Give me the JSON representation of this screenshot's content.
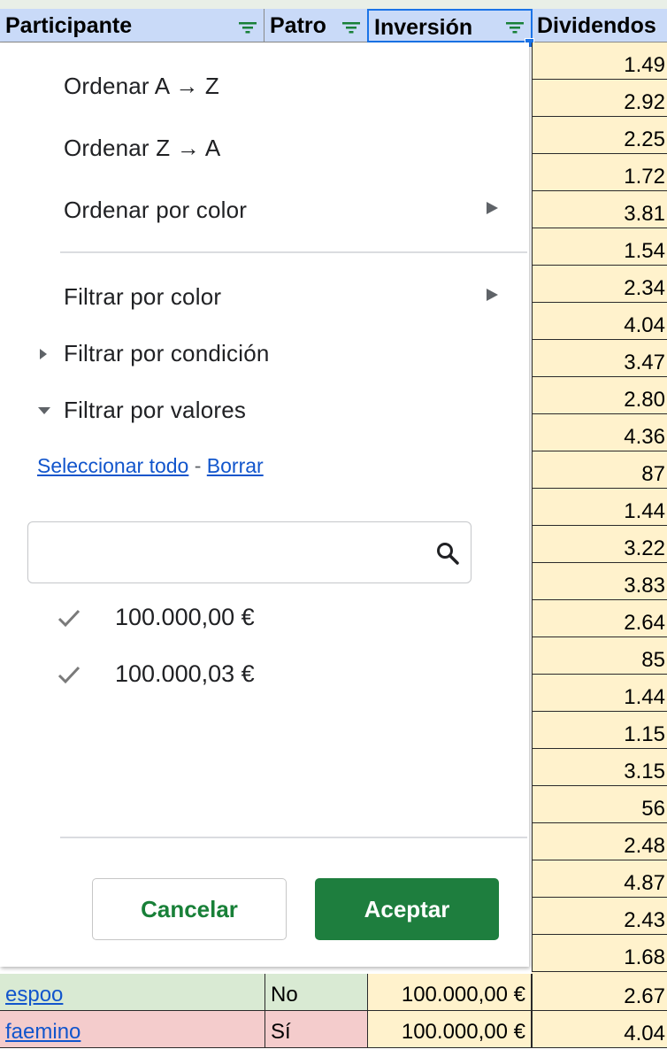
{
  "header": {
    "participante": "Participante",
    "patro": "Patro",
    "inversion": "Inversión",
    "dividendos": "Dividendos"
  },
  "dividendos_values": [
    "1.49",
    "2.92",
    "2.25",
    "1.72",
    "3.81",
    "1.54",
    "2.34",
    "4.04",
    "3.47",
    "2.80",
    "4.36",
    "87",
    "1.44",
    "3.22",
    "3.83",
    "2.64",
    "85",
    "1.44",
    "1.15",
    "3.15",
    "56",
    "2.48",
    "4.87",
    "2.43",
    "1.68"
  ],
  "rows": [
    {
      "participante": "espoo",
      "patro": "No",
      "inversion": "100.000,00 €",
      "dividendos": "2.67",
      "color": "#d9ead3"
    },
    {
      "participante": "faemino",
      "patro": "Sí",
      "inversion": "100.000,00 €",
      "dividendos": "4.04",
      "color": "#f4cccc"
    }
  ],
  "menu": {
    "sort_az": "Ordenar A → Z",
    "sort_za": "Ordenar Z → A",
    "sort_color": "Ordenar por color",
    "filter_color": "Filtrar por color",
    "filter_condition": "Filtrar por condición",
    "filter_values": "Filtrar por valores",
    "select_all": "Seleccionar todo",
    "dash": "-",
    "clear": "Borrar",
    "search_value": "",
    "values": [
      "100.000,00 €",
      "100.000,03 €"
    ],
    "cancel": "Cancelar",
    "ok": "Aceptar"
  },
  "colors": {
    "header_bg": "#c9daf8",
    "dividendos_bg": "#fff2cc",
    "accent_green": "#1e7e3e",
    "link_blue": "#1155cc",
    "active_blue": "#1a73e8"
  },
  "icons": {
    "filter": "filter-icon",
    "search": "search-icon",
    "check": "check-icon",
    "submenu": "submenu-arrow-icon"
  }
}
